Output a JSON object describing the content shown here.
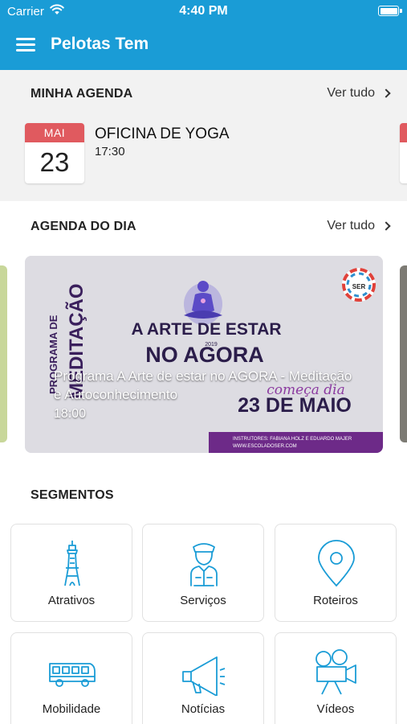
{
  "status_bar": {
    "carrier": "Carrier",
    "time": "4:40 PM"
  },
  "header": {
    "title": "Pelotas Tem"
  },
  "my_agenda": {
    "heading": "MINHA AGENDA",
    "see_all": "Ver tudo",
    "event": {
      "month": "MAI",
      "day": "23",
      "title": "OFICINA DE YOGA",
      "time": "17:30"
    }
  },
  "day_agenda": {
    "heading": "AGENDA DO DIA",
    "see_all": "Ver tudo",
    "card": {
      "title": "Programa A Arte de estar no AGORA - Meditação e Autoconhecimento",
      "time": "18:00",
      "poster": {
        "vertical_1": "PROGRAMA DE",
        "vertical_2": "MEDITAÇÃO",
        "headline_1": "A ARTE DE ESTAR",
        "headline_2": "NO AGORA",
        "year": "2019",
        "starts": "começa dia",
        "date": "23 DE MAIO",
        "instructors": "INSTRUTORES: FABIANA HOLZ E EDUARDO MAJER",
        "site": "WWW.ESCOLADOSER.COM",
        "logo_text": "SER"
      }
    }
  },
  "segments": {
    "heading": "SEGMENTOS",
    "items": [
      {
        "label": "Atrativos",
        "icon": "tower-icon"
      },
      {
        "label": "Serviços",
        "icon": "service-person-icon"
      },
      {
        "label": "Roteiros",
        "icon": "map-pin-icon"
      },
      {
        "label": "Mobilidade",
        "icon": "bus-icon"
      },
      {
        "label": "Notícias",
        "icon": "megaphone-icon"
      },
      {
        "label": "Vídeos",
        "icon": "video-camera-icon"
      }
    ]
  },
  "colors": {
    "brand": "#1a9cd6",
    "calendar_red": "#e05a5f",
    "poster_purple": "#6d2a88",
    "icon_blue": "#1a9cd6"
  }
}
